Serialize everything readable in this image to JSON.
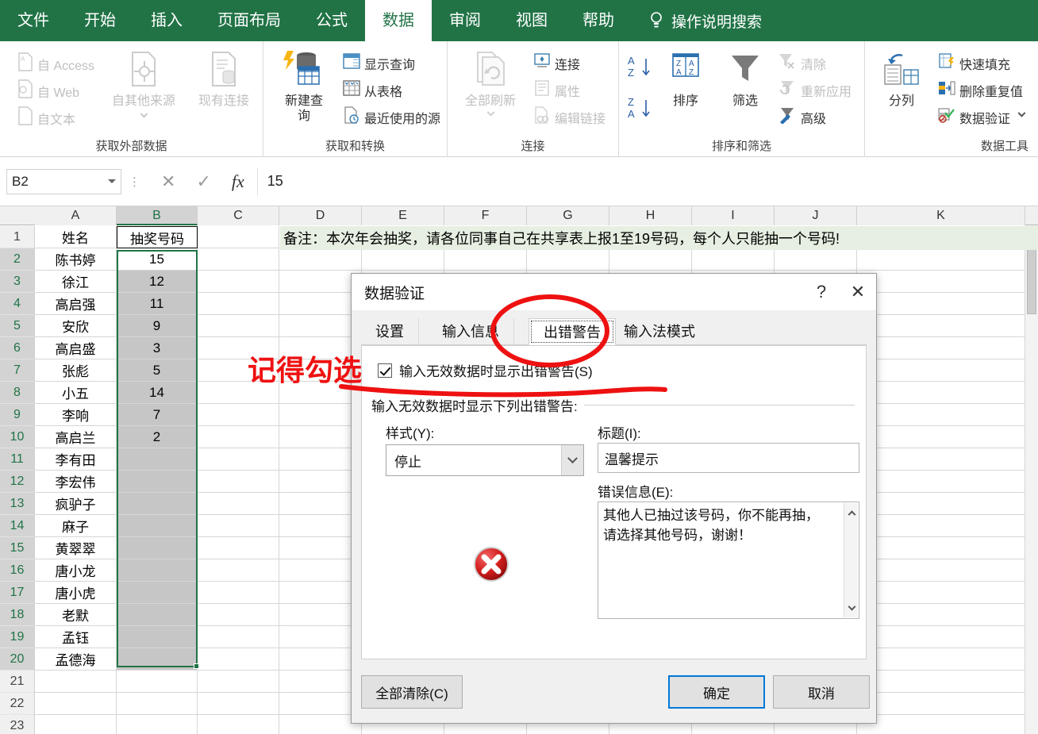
{
  "ribbon": {
    "tabs": [
      {
        "label": "文件",
        "active": false
      },
      {
        "label": "开始",
        "active": false
      },
      {
        "label": "插入",
        "active": false
      },
      {
        "label": "页面布局",
        "active": false
      },
      {
        "label": "公式",
        "active": false
      },
      {
        "label": "数据",
        "active": true
      },
      {
        "label": "审阅",
        "active": false
      },
      {
        "label": "视图",
        "active": false
      },
      {
        "label": "帮助",
        "active": false
      }
    ],
    "tellme": "操作说明搜索",
    "tellme_icon": "lightbulb-icon",
    "accent_color": "#217346",
    "groups": [
      {
        "name": "获取外部数据",
        "items": [
          {
            "label": "自 Access",
            "icon": "access-file-icon",
            "dim": true
          },
          {
            "label": "自 Web",
            "icon": "web-file-icon",
            "dim": true
          },
          {
            "label": "自文本",
            "icon": "text-file-icon",
            "dim": true
          },
          {
            "label": "自其他来源",
            "icon": "other-sources-icon",
            "dim": true
          },
          {
            "label": "现有连接",
            "icon": "existing-connections-icon",
            "dim": true
          }
        ]
      },
      {
        "name": "获取和转换",
        "items": [
          {
            "label": "新建查询",
            "icon": "new-query-icon",
            "dim": false
          },
          {
            "label": "显示查询",
            "icon": "show-queries-icon",
            "dim": false
          },
          {
            "label": "从表格",
            "icon": "from-table-icon",
            "dim": false
          },
          {
            "label": "最近使用的源",
            "icon": "recent-sources-icon",
            "dim": false
          }
        ]
      },
      {
        "name": "连接",
        "items": [
          {
            "label": "全部刷新",
            "icon": "refresh-all-icon",
            "dim": true
          },
          {
            "label": "连接",
            "icon": "connections-icon",
            "dim": false
          },
          {
            "label": "属性",
            "icon": "properties-icon",
            "dim": true
          },
          {
            "label": "编辑链接",
            "icon": "edit-links-icon",
            "dim": true
          }
        ]
      },
      {
        "name": "排序和筛选",
        "items": [
          {
            "label": "排序",
            "icon": "sort-icon",
            "dim": false
          },
          {
            "label": "筛选",
            "icon": "filter-icon",
            "dim": false
          },
          {
            "label": "清除",
            "icon": "clear-filter-icon",
            "dim": true
          },
          {
            "label": "重新应用",
            "icon": "reapply-icon",
            "dim": true
          },
          {
            "label": "高级",
            "icon": "advanced-filter-icon",
            "dim": false
          }
        ]
      },
      {
        "name": "数据工具",
        "items": [
          {
            "label": "分列",
            "icon": "text-to-columns-icon",
            "dim": false
          },
          {
            "label": "快速填充",
            "icon": "flash-fill-icon",
            "dim": false
          },
          {
            "label": "删除重复值",
            "icon": "remove-duplicates-icon",
            "dim": false
          },
          {
            "label": "数据验证",
            "icon": "data-validation-icon",
            "dim": false
          }
        ]
      }
    ]
  },
  "formula_bar": {
    "name_box": "B2",
    "value": "15",
    "cancel_icon": "x-icon",
    "enter_icon": "check-icon",
    "fx_icon": "fx-icon"
  },
  "sheet": {
    "columns": [
      "A",
      "B",
      "C",
      "D",
      "E",
      "F",
      "G",
      "H",
      "I",
      "J",
      "K"
    ],
    "selected_column": "B",
    "rows": [
      1,
      2,
      3,
      4,
      5,
      6,
      7,
      8,
      9,
      10,
      11,
      12,
      13,
      14,
      15,
      16,
      17,
      18,
      19,
      20,
      21,
      22,
      23
    ],
    "headers": {
      "a": "姓名",
      "b": "抽奖号码"
    },
    "note": "备注：本次年会抽奖，请各位同事自己在共享表上报1至19号码，每个人只能抽一个号码!",
    "data": [
      {
        "row": 2,
        "name": "陈书婷",
        "num": "15"
      },
      {
        "row": 3,
        "name": "徐江",
        "num": "12"
      },
      {
        "row": 4,
        "name": "高启强",
        "num": "11"
      },
      {
        "row": 5,
        "name": "安欣",
        "num": "9"
      },
      {
        "row": 6,
        "name": "高启盛",
        "num": "3"
      },
      {
        "row": 7,
        "name": "张彪",
        "num": "5"
      },
      {
        "row": 8,
        "name": "小五",
        "num": "14"
      },
      {
        "row": 9,
        "name": "李响",
        "num": "7"
      },
      {
        "row": 10,
        "name": "高启兰",
        "num": "2"
      },
      {
        "row": 11,
        "name": "李有田",
        "num": ""
      },
      {
        "row": 12,
        "name": "李宏伟",
        "num": ""
      },
      {
        "row": 13,
        "name": "疯驴子",
        "num": ""
      },
      {
        "row": 14,
        "name": "麻子",
        "num": ""
      },
      {
        "row": 15,
        "name": "黄翠翠",
        "num": ""
      },
      {
        "row": 16,
        "name": "唐小龙",
        "num": ""
      },
      {
        "row": 17,
        "name": "唐小虎",
        "num": ""
      },
      {
        "row": 18,
        "name": "老默",
        "num": ""
      },
      {
        "row": 19,
        "name": "孟钰",
        "num": ""
      },
      {
        "row": 20,
        "name": "孟德海",
        "num": ""
      }
    ]
  },
  "dialog": {
    "title": "数据验证",
    "help_icon": "question-mark-icon",
    "close_icon": "close-icon",
    "tabs": [
      {
        "label": "设置",
        "active": false
      },
      {
        "label": "输入信息",
        "active": false
      },
      {
        "label": "出错警告",
        "active": true
      },
      {
        "label": "输入法模式",
        "active": false
      }
    ],
    "checkbox_label": "输入无效数据时显示出错警告(S)",
    "checkbox_checked": true,
    "group_header": "输入无效数据时显示下列出错警告:",
    "style_label": "样式(Y):",
    "style_value": "停止",
    "title_label": "标题(I):",
    "title_value": "温馨提示",
    "error_label": "错误信息(E):",
    "error_value": "其他人已抽过该号码，你不能再抽，请选择其他号码，谢谢！",
    "error_icon": "stop-error-icon",
    "buttons": {
      "clear_all": "全部清除(C)",
      "ok": "确定",
      "cancel": "取消"
    }
  },
  "annotations": {
    "text": "记得勾选",
    "text_color": "#ee1111",
    "ellipse": "red-ellipse-around-error-alert-tab",
    "underline": "red-underline-under-checkbox"
  }
}
